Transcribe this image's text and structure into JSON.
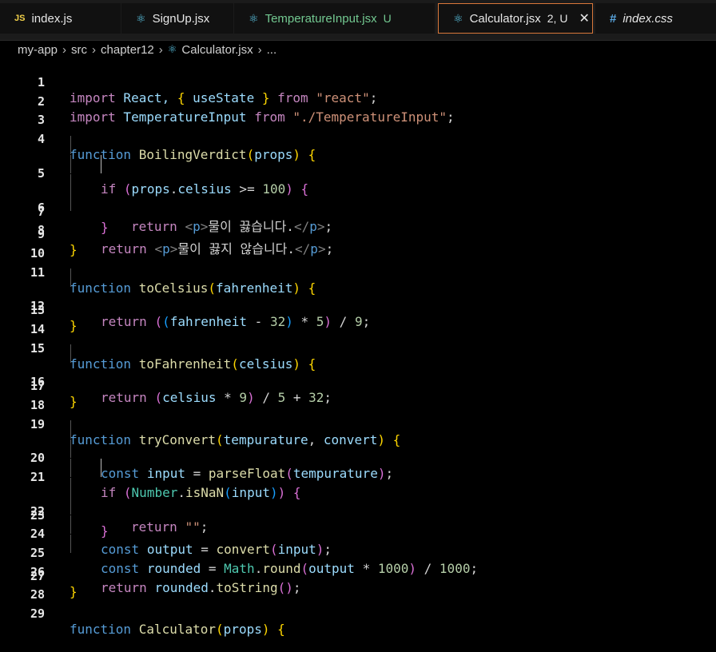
{
  "tabs": [
    {
      "icon": "JS",
      "label": "index.js"
    },
    {
      "icon": "⚛",
      "label": "SignUp.jsx"
    },
    {
      "icon": "⚛",
      "label": "TemperatureInput.jsx",
      "badge": "U"
    },
    {
      "icon": "⚛",
      "label": "Calculator.jsx",
      "badge": "2, U",
      "close": "✕"
    },
    {
      "icon": "#",
      "label": "index.css"
    }
  ],
  "breadcrumb": [
    "my-app",
    "src",
    "chapter12",
    "Calculator.jsx",
    "..."
  ],
  "code": {
    "l1": {
      "n": "1",
      "t": [
        "import",
        " React, ",
        "{",
        " useState ",
        "}",
        " from ",
        "\"react\"",
        ";"
      ]
    },
    "l2": {
      "n": "2",
      "t": [
        "import",
        " TemperatureInput ",
        "from",
        " ",
        "\"./TemperatureInput\"",
        ";"
      ]
    },
    "l3": {
      "n": "3"
    },
    "l4": {
      "n": "4",
      "t": [
        "function",
        " ",
        "BoilingVerdict",
        "(",
        "props",
        ")",
        " ",
        "{"
      ]
    },
    "l5": {
      "n": "5",
      "t": [
        "if",
        " ",
        "(",
        "props",
        ".",
        "celsius",
        " >= ",
        "100",
        ")",
        " ",
        "{"
      ]
    },
    "l6": {
      "n": "6",
      "t": [
        "return",
        " ",
        "<",
        "p",
        ">",
        "물이 끓습니다.",
        "</",
        "p",
        ">",
        ";"
      ]
    },
    "l7": {
      "n": "7",
      "t": [
        "}"
      ]
    },
    "l8": {
      "n": "8",
      "t": [
        "return",
        " ",
        "<",
        "p",
        ">",
        "물이 끓지 않습니다.",
        "</",
        "p",
        ">",
        ";"
      ]
    },
    "l9": {
      "n": "9",
      "t": [
        "}"
      ]
    },
    "l10": {
      "n": "10"
    },
    "l11": {
      "n": "11",
      "t": [
        "function",
        " ",
        "toCelsius",
        "(",
        "fahrenheit",
        ")",
        " ",
        "{"
      ]
    },
    "l12": {
      "n": "12",
      "t": [
        "return",
        " ",
        "(",
        "(",
        "fahrenheit",
        " - ",
        "32",
        ")",
        " * ",
        "5",
        ")",
        " / ",
        "9",
        ";"
      ]
    },
    "l13": {
      "n": "13",
      "t": [
        "}"
      ]
    },
    "l14": {
      "n": "14"
    },
    "l15": {
      "n": "15",
      "t": [
        "function",
        " ",
        "toFahrenheit",
        "(",
        "celsius",
        ")",
        " ",
        "{"
      ]
    },
    "l16": {
      "n": "16",
      "t": [
        "return",
        " ",
        "(",
        "celsius",
        " * ",
        "9",
        ")",
        " / ",
        "5",
        " + ",
        "32",
        ";"
      ]
    },
    "l17": {
      "n": "17",
      "t": [
        "}"
      ]
    },
    "l18": {
      "n": "18"
    },
    "l19": {
      "n": "19",
      "t": [
        "function",
        " ",
        "tryConvert",
        "(",
        "tempurature",
        ", ",
        "convert",
        ")",
        " ",
        "{"
      ]
    },
    "l20": {
      "n": "20",
      "t": [
        "const",
        " ",
        "input",
        " = ",
        "parseFloat",
        "(",
        "tempurature",
        ")",
        ";"
      ]
    },
    "l21": {
      "n": "21",
      "t": [
        "if",
        " ",
        "(",
        "Number",
        ".",
        "isNaN",
        "(",
        "input",
        ")",
        ")",
        " ",
        "{"
      ]
    },
    "l22": {
      "n": "22",
      "t": [
        "return",
        " ",
        "\"\"",
        ";"
      ]
    },
    "l23": {
      "n": "23",
      "t": [
        "}"
      ]
    },
    "l24": {
      "n": "24",
      "t": [
        "const",
        " ",
        "output",
        " = ",
        "convert",
        "(",
        "input",
        ")",
        ";"
      ]
    },
    "l25": {
      "n": "25",
      "t": [
        "const",
        " ",
        "rounded",
        " = ",
        "Math",
        ".",
        "round",
        "(",
        "output",
        " * ",
        "1000",
        ")",
        " / ",
        "1000",
        ";"
      ]
    },
    "l26": {
      "n": "26",
      "t": [
        "return",
        " ",
        "rounded",
        ".",
        "toString",
        "(",
        ")",
        ";"
      ]
    },
    "l27": {
      "n": "27",
      "t": [
        "}"
      ]
    },
    "l28": {
      "n": "28"
    },
    "l29": {
      "n": "29",
      "t": [
        "function",
        " ",
        "Calculator",
        "(",
        "props",
        ")",
        " ",
        "{"
      ]
    }
  }
}
